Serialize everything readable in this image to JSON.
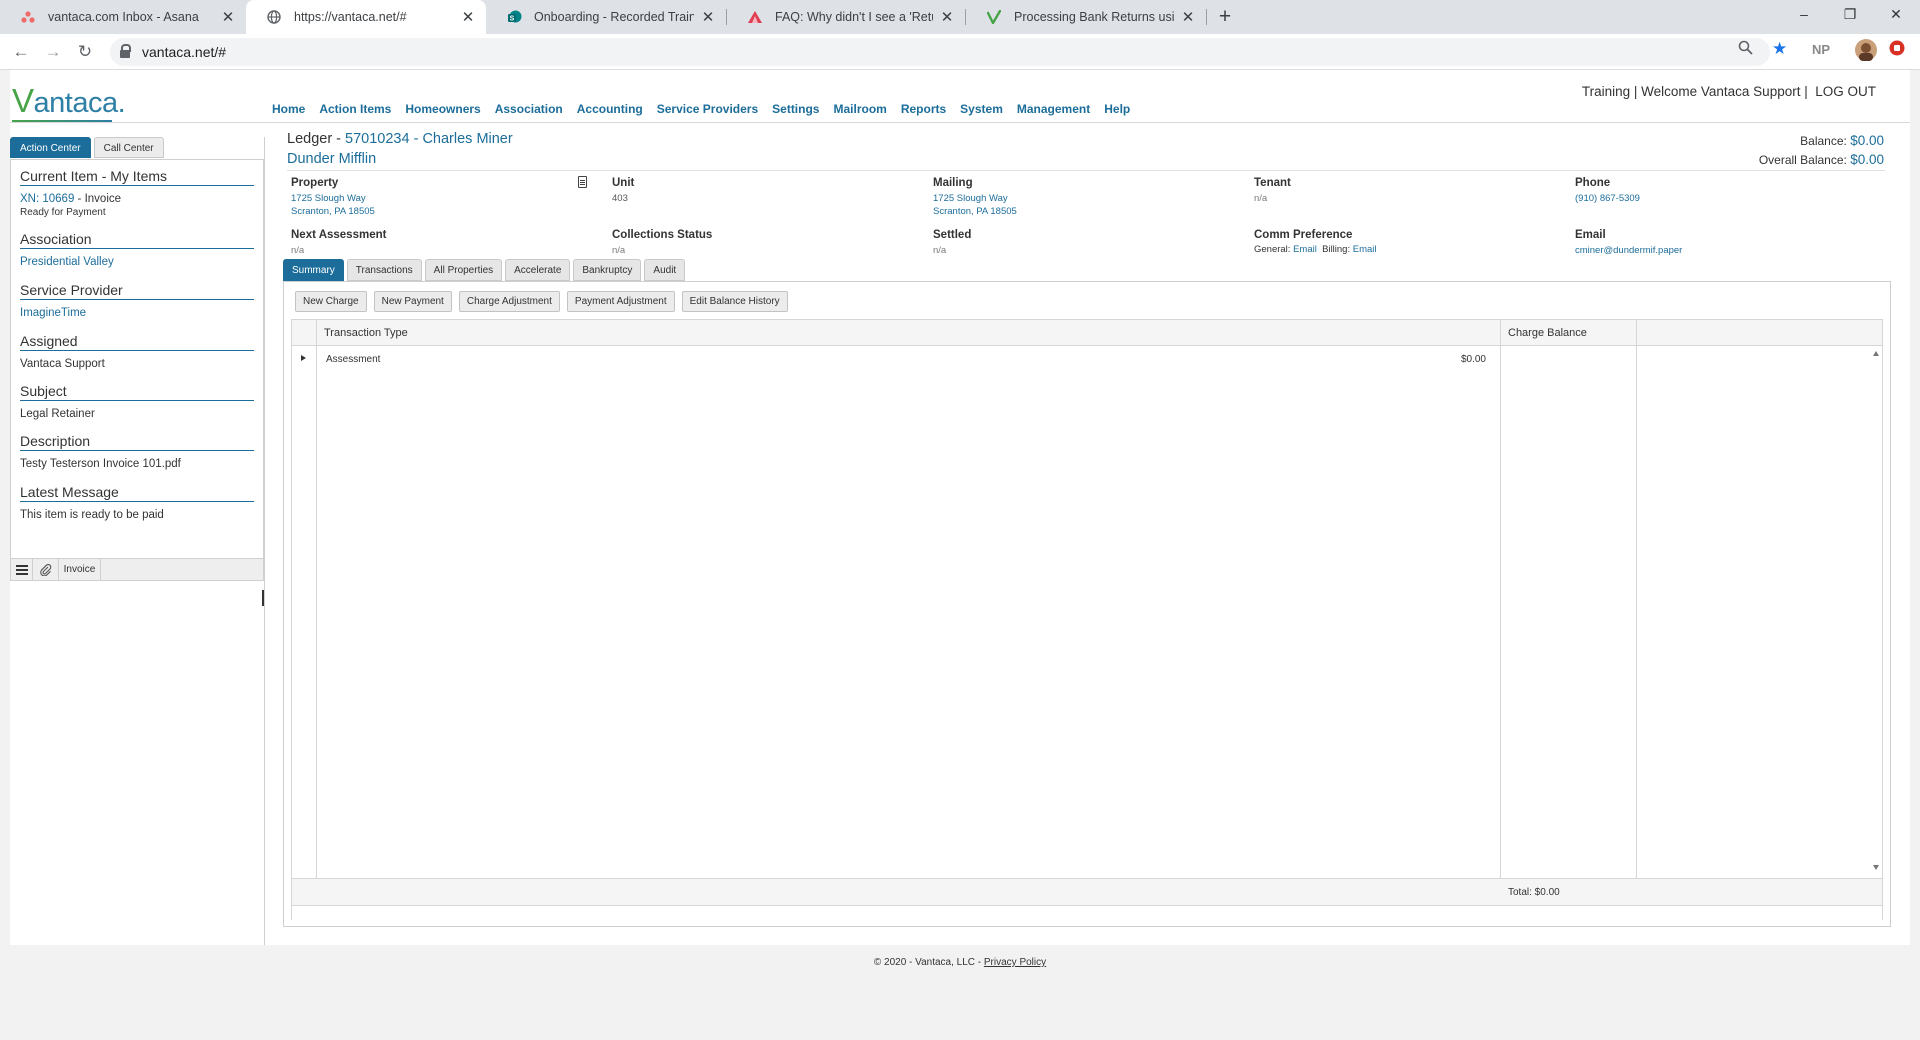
{
  "browser": {
    "tabs": [
      {
        "title": "vantaca.com Inbox - Asana",
        "icon": "asana-icon"
      },
      {
        "title": "https://vantaca.net/#",
        "icon": "globe-icon"
      },
      {
        "title": "Onboarding - Recorded Training",
        "icon": "sharepoint-icon"
      },
      {
        "title": "FAQ: Why didn't I see a 'Return' b",
        "icon": "faq-icon"
      },
      {
        "title": "Processing Bank Returns using th",
        "icon": "vantaca-icon"
      }
    ],
    "url": "vantaca.net/#",
    "profile_initials": "NP"
  },
  "app": {
    "logo_text": "antaca.",
    "logo_letter": "V",
    "nav": [
      "Home",
      "Action Items",
      "Homeowners",
      "Association",
      "Accounting",
      "Service Providers",
      "Settings",
      "Mailroom",
      "Reports",
      "System",
      "Management",
      "Help"
    ],
    "top_right": {
      "text": "Training | Welcome Vantaca Support |",
      "logout": "LOG OUT"
    }
  },
  "left_panel": {
    "tabs": [
      "Action Center",
      "Call Center"
    ],
    "sections": [
      {
        "heading": "Current Item - My Items",
        "value_link": "XN: 10669",
        "value_rest": " - Invoice",
        "sub": "Ready for Payment"
      },
      {
        "heading": "Association",
        "value": "Presidential Valley",
        "link": true
      },
      {
        "heading": "Service Provider",
        "value": "ImagineTime",
        "link": true
      },
      {
        "heading": "Assigned",
        "value": "Vantaca Support",
        "link": false
      },
      {
        "heading": "Subject",
        "value": "Legal Retainer",
        "link": false
      },
      {
        "heading": "Description",
        "value": "Testy Testerson Invoice 101.pdf",
        "link": false
      },
      {
        "heading": "Latest Message",
        "value": "This item is ready to be paid",
        "link": false
      }
    ],
    "toolbar_label": "Invoice"
  },
  "ledger": {
    "title_prefix": "Ledger - ",
    "title_link": "57010234 - Charles Miner",
    "association": "Dunder Mifflin",
    "balance_label": "Balance: ",
    "balance": "$0.00",
    "overall_label": "Overall Balance: ",
    "overall_balance": "$0.00",
    "info": {
      "property_label": "Property",
      "property_line1": "1725 Slough Way",
      "property_line2": "Scranton, PA 18505",
      "unit_label": "Unit",
      "unit_value": "403",
      "mailing_label": "Mailing",
      "mailing_line1": "1725 Slough Way",
      "mailing_line2": "Scranton, PA 18505",
      "tenant_label": "Tenant",
      "tenant_value": "n/a",
      "phone_label": "Phone",
      "phone_value": "(910) 867-5309",
      "next_assessment_label": "Next Assessment",
      "next_assessment_value": "n/a",
      "collections_label": "Collections Status",
      "collections_value": "n/a",
      "settled_label": "Settled",
      "settled_value": "n/a",
      "comm_label": "Comm Preference",
      "comm_general_label": "General:",
      "comm_general": "Email",
      "comm_billing_label": "Billing:",
      "comm_billing": "Email",
      "email_label": "Email",
      "email_value": "cminer@dundermif.paper"
    },
    "tabs": [
      "Summary",
      "Transactions",
      "All Properties",
      "Accelerate",
      "Bankruptcy",
      "Audit"
    ],
    "buttons": [
      "New Charge",
      "New Payment",
      "Charge Adjustment",
      "Payment Adjustment",
      "Edit Balance History"
    ],
    "grid": {
      "columns": [
        "Transaction Type",
        "Charge Balance"
      ],
      "rows": [
        {
          "type": "Assessment",
          "balance": "$0.00"
        }
      ],
      "total": "Total: $0.00"
    }
  },
  "footer": {
    "copyright": "© 2020 - Vantaca, LLC - ",
    "privacy": "Privacy Policy"
  }
}
